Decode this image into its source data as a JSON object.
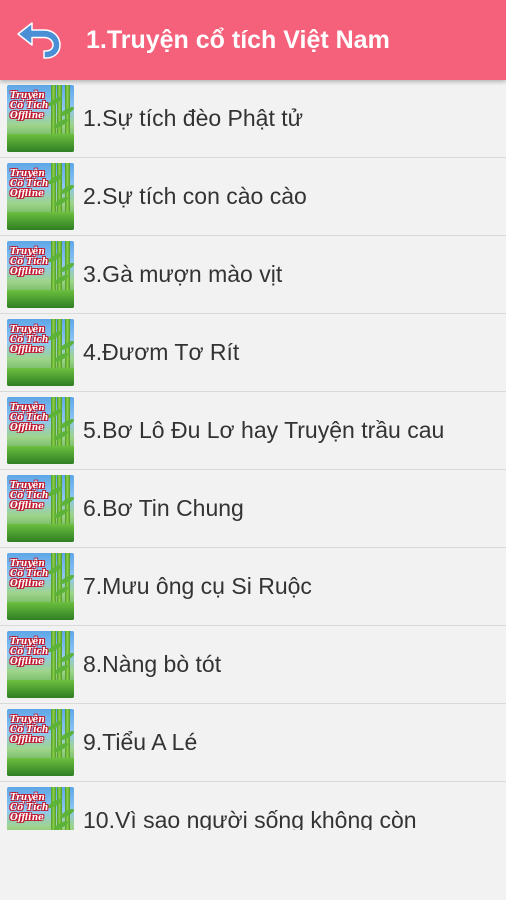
{
  "header": {
    "title": "1.Truyện cổ tích Việt Nam",
    "back_icon": "back-arrow-icon",
    "background_color": "#f5607a"
  },
  "thumbnail": {
    "logo_text": "Truyện Cổ Tích Offline"
  },
  "stories": [
    {
      "label": "1.Sự tích đèo Phật tử"
    },
    {
      "label": "2.Sự tích con cào cào"
    },
    {
      "label": "3.Gà mượn mào vịt"
    },
    {
      "label": "4.Đươm Tơ Rít"
    },
    {
      "label": "5.Bơ Lô Đu Lơ hay Truyện trầu cau"
    },
    {
      "label": "6.Bơ Tin Chung"
    },
    {
      "label": "7.Mưu ông cụ Si Ruộc"
    },
    {
      "label": "8.Nàng bò tót"
    },
    {
      "label": "9.Tiểu A Lé"
    },
    {
      "label": "10.Vì sao người sống không còn"
    }
  ]
}
